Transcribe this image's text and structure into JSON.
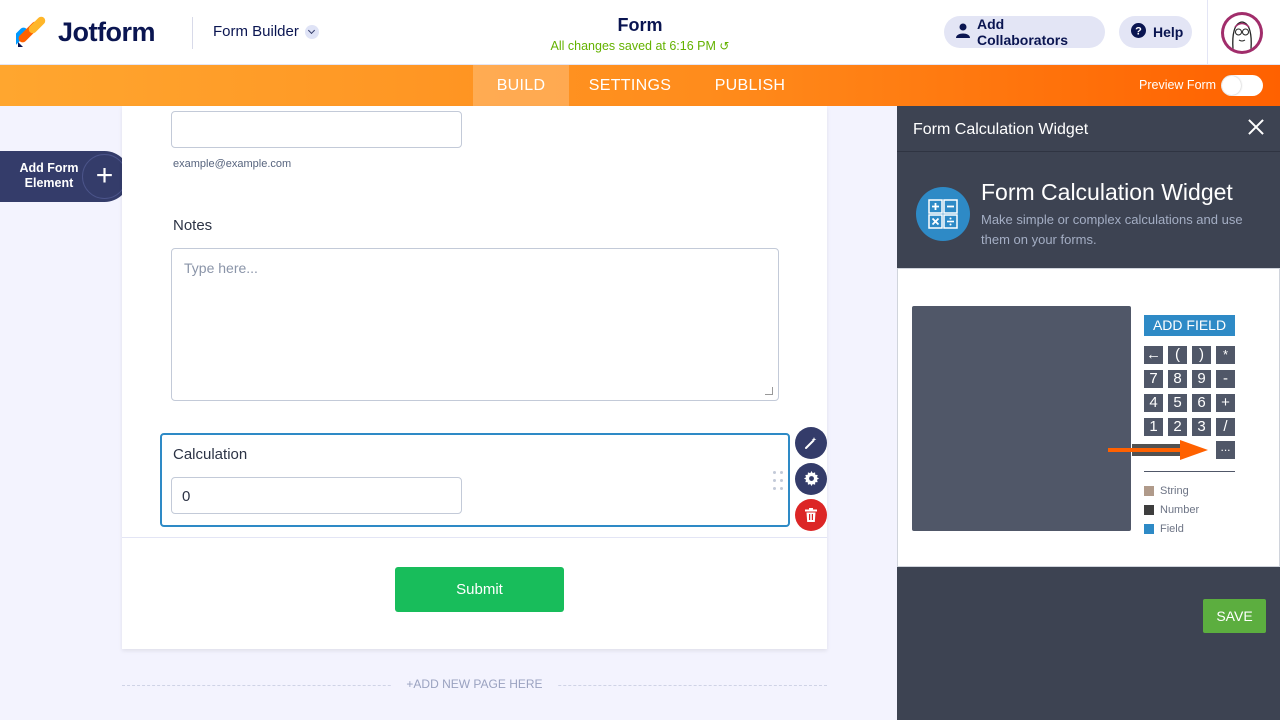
{
  "header": {
    "logo_text": "Jotform",
    "builder_dropdown": "Form Builder",
    "form_title": "Form",
    "saved_status": "All changes saved at 6:16 PM",
    "add_collaborators": "Add Collaborators",
    "help": "Help"
  },
  "nav": {
    "tabs": [
      {
        "label": "BUILD",
        "active": true
      },
      {
        "label": "SETTINGS",
        "active": false
      },
      {
        "label": "PUBLISH",
        "active": false
      }
    ],
    "preview_form": "Preview Form"
  },
  "sidebar": {
    "add_form_element": "Add Form Element"
  },
  "form": {
    "email_sublabel": "example@example.com",
    "notes_label": "Notes",
    "notes_placeholder": "Type here...",
    "calc_label": "Calculation",
    "calc_value": "0",
    "submit_label": "Submit",
    "add_page": "+ADD NEW PAGE HERE"
  },
  "panel": {
    "header_title": "Form Calculation Widget",
    "widget_title": "Form Calculation Widget",
    "widget_desc": "Make simple or complex calculations and use them on your forms.",
    "add_field": "ADD FIELD",
    "keys": [
      [
        "←",
        "(",
        ")",
        "*"
      ],
      [
        "7",
        "8",
        "9",
        "-"
      ],
      [
        "4",
        "5",
        "6",
        "+"
      ],
      [
        "1",
        "2",
        "3",
        "/"
      ]
    ],
    "more_key": "...",
    "legend": [
      {
        "label": "String",
        "color": "#b09a8a"
      },
      {
        "label": "Number",
        "color": "#3e3e3e"
      },
      {
        "label": "Field",
        "color": "#2e8ac6"
      }
    ],
    "save": "SAVE"
  },
  "colors": {
    "accent_orange": "#ff6100",
    "brand_navy": "#0a1551",
    "submit_green": "#18bd5b",
    "selection_blue": "#2e8ac6"
  }
}
